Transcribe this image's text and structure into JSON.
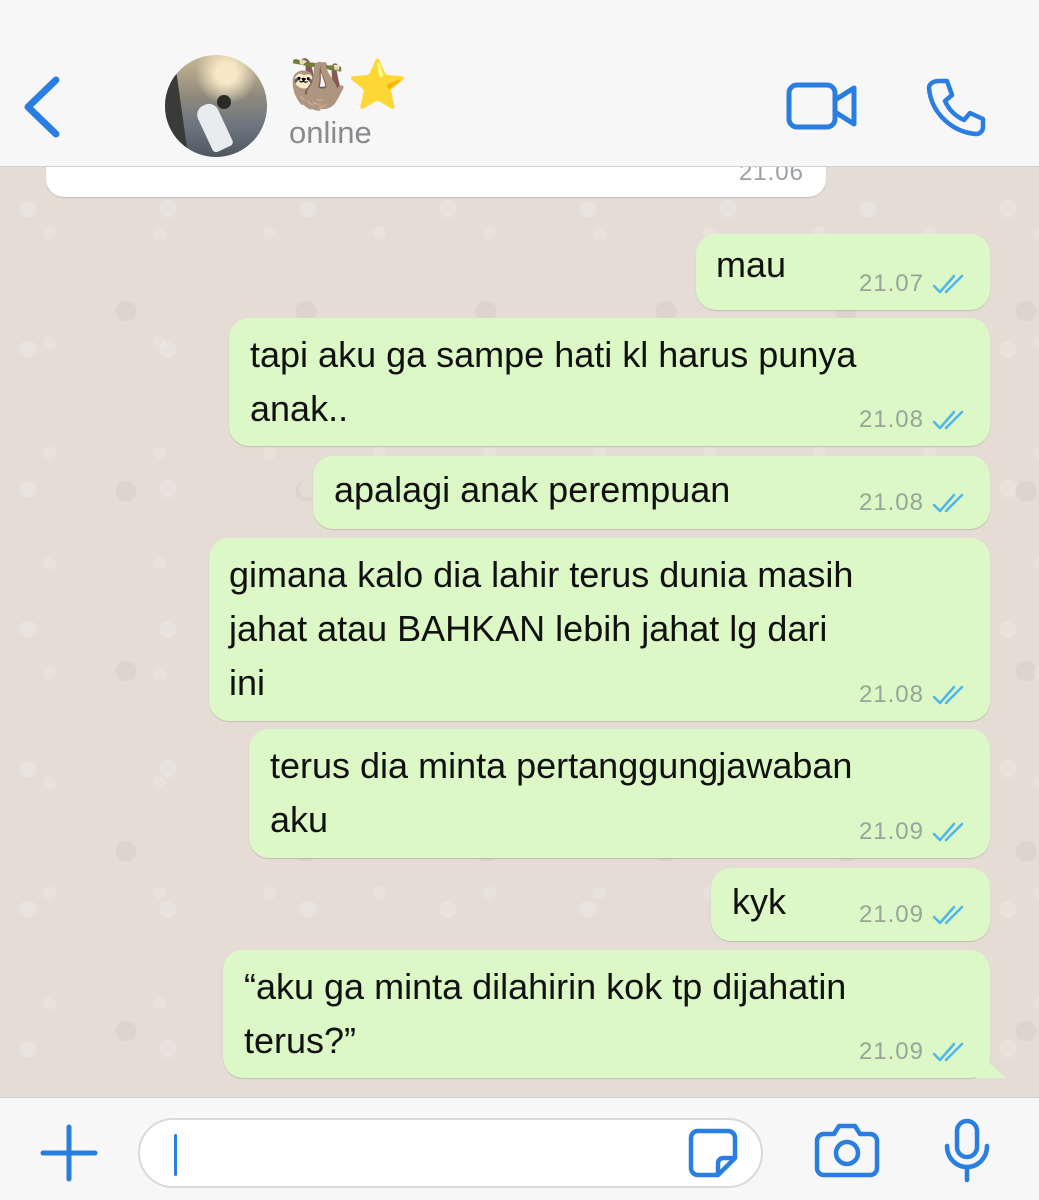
{
  "header": {
    "contact_name": "🦥⭐",
    "status": "online"
  },
  "previous_message": {
    "time": "21.06"
  },
  "messages": [
    {
      "lines": [
        "mau"
      ],
      "time": "21.07"
    },
    {
      "lines": [
        "tapi aku ga sampe hati kl harus punya",
        "anak.."
      ],
      "time": "21.08"
    },
    {
      "lines": [
        "apalagi anak perempuan"
      ],
      "time": "21.08"
    },
    {
      "lines": [
        "gimana kalo dia lahir terus dunia masih",
        "jahat atau BAHKAN lebih jahat lg dari",
        "ini"
      ],
      "time": "21.08"
    },
    {
      "lines": [
        "terus dia minta pertanggungjawaban",
        "aku"
      ],
      "time": "21.09"
    },
    {
      "lines": [
        "kyk"
      ],
      "time": "21.09"
    },
    {
      "lines": [
        "“aku ga minta dilahirin kok tp dijahatin",
        "terus?”"
      ],
      "time": "21.09"
    }
  ],
  "input": {
    "value": "",
    "placeholder": ""
  },
  "colors": {
    "accent": "#2a7de1",
    "outgoing_bubble": "#dcf8c6",
    "read_ticks": "#4fb6ec",
    "chat_background": "#e5ddd5"
  },
  "icons": {
    "back": "chevron-left-icon",
    "video": "video-camera-icon",
    "call": "phone-icon",
    "attach": "plus-icon",
    "sticker": "sticker-icon",
    "camera": "camera-icon",
    "mic": "microphone-icon",
    "status": "double-check-icon"
  }
}
